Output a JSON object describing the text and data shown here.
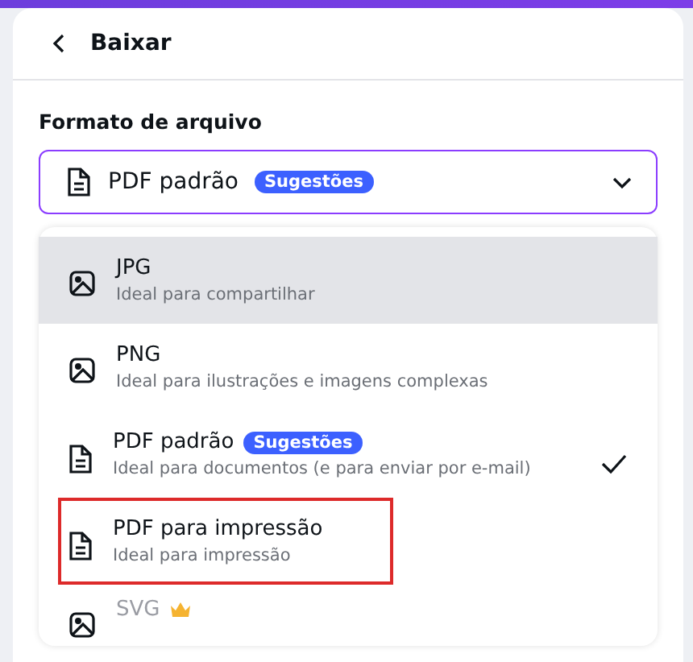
{
  "header": {
    "title": "Baixar"
  },
  "file_format": {
    "label": "Formato de arquivo",
    "value": "PDF padrão",
    "badge": "Sugestões",
    "expanded": true
  },
  "options": [
    {
      "kind": "image",
      "name": "JPG",
      "description": "Ideal para compartilhar",
      "highlighted": true,
      "selected": false,
      "outlined": false,
      "premium": false,
      "disabled": false
    },
    {
      "kind": "image",
      "name": "PNG",
      "description": "Ideal para ilustrações e imagens complexas",
      "highlighted": false,
      "selected": false,
      "outlined": false,
      "premium": false,
      "disabled": false
    },
    {
      "kind": "document",
      "name": "PDF padrão",
      "badge": "Sugestões",
      "description": "Ideal para documentos (e para enviar por e-mail)",
      "highlighted": false,
      "selected": true,
      "outlined": false,
      "premium": false,
      "disabled": false
    },
    {
      "kind": "document",
      "name": "PDF para impressão",
      "description": "Ideal para impressão",
      "highlighted": false,
      "selected": false,
      "outlined": true,
      "premium": false,
      "disabled": false
    },
    {
      "kind": "image",
      "name": "SVG",
      "highlighted": false,
      "selected": false,
      "outlined": false,
      "premium": true,
      "disabled": true
    }
  ]
}
